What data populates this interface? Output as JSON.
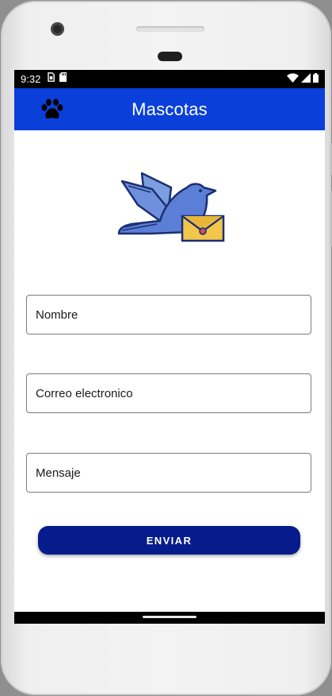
{
  "status_bar": {
    "time": "9:32",
    "left_icons": [
      "sim-card-icon",
      "sd-card-icon"
    ],
    "right_icons": [
      "wifi-icon",
      "signal-icon",
      "battery-icon"
    ]
  },
  "app_bar": {
    "title": "Mascotas",
    "icon": "paw-icon",
    "color": "#0a3fd9"
  },
  "hero": {
    "icon": "dove-with-envelope-icon"
  },
  "form": {
    "name_placeholder": "Nombre",
    "email_placeholder": "Correo electronico",
    "message_placeholder": "Mensaje",
    "submit_label": "ENVIAR",
    "submit_color": "#071c8c"
  }
}
